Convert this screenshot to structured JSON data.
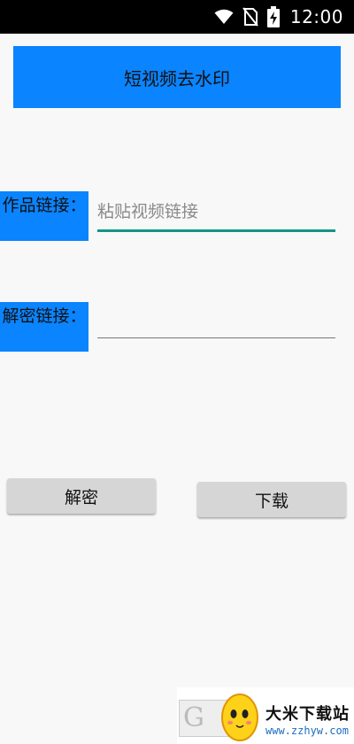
{
  "status_bar": {
    "time": "12:00",
    "icons": [
      "wifi-icon",
      "no-sim-icon",
      "battery-charging-icon"
    ]
  },
  "title": "短视频去水印",
  "fields": [
    {
      "label": "作品链接：",
      "placeholder": "粘贴视频链接",
      "value": ""
    },
    {
      "label": "解密链接：",
      "placeholder": "",
      "value": ""
    }
  ],
  "buttons": {
    "decrypt": "解密",
    "download": "下载"
  },
  "watermark": {
    "name": "大米下载站",
    "url": "www.zzhyw.com"
  },
  "colors": {
    "accent": "#0a84ff",
    "input_focus": "#129688",
    "button_bg": "#d6d6d6"
  }
}
